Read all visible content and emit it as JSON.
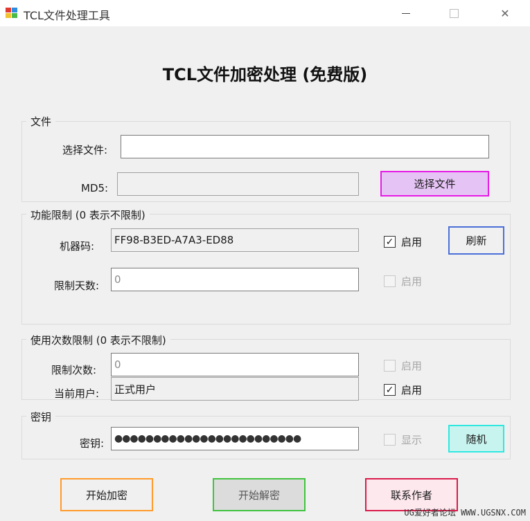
{
  "window": {
    "title": "TCL文件处理工具",
    "close_glyph": "✕"
  },
  "header": {
    "title": "TCL文件加密处理 (免费版)"
  },
  "file_group": {
    "legend": "文件",
    "select_label": "选择文件:",
    "select_value": "",
    "md5_label": "MD5:",
    "md5_value": "",
    "select_button": "选择文件"
  },
  "function_group": {
    "legend": "功能限制 (0 表示不限制)",
    "machine_label": "机器码:",
    "machine_value": "FF98-B3ED-A7A3-ED88",
    "machine_enable": {
      "label": "启用",
      "checked": true
    },
    "refresh_button": "刷新",
    "days_label": "限制天数:",
    "days_value": "0",
    "days_enable": {
      "label": "启用",
      "checked": false
    }
  },
  "usage_group": {
    "legend": "使用次数限制 (0 表示不限制)",
    "count_label": "限制次数:",
    "count_value": "0",
    "count_enable": {
      "label": "启用",
      "checked": false
    },
    "user_label": "当前用户:",
    "user_value": "正式用户",
    "user_enable": {
      "label": "启用",
      "checked": true
    }
  },
  "key_group": {
    "legend": "密钥",
    "key_label": "密钥:",
    "key_value": "●●●●●●●●●●●●●●●●●●●●●●●●",
    "show_toggle": {
      "label": "显示",
      "checked": false
    },
    "random_button": "随机"
  },
  "actions": {
    "encrypt": "开始加密",
    "decrypt": "开始解密",
    "contact": "联系作者"
  },
  "watermark": "UG爱好者论坛 WWW.UGSNX.COM",
  "colors": {
    "select_button_border": "#e619e6",
    "select_button_bg": "#e6c3f5",
    "refresh_border": "#4a6fd8",
    "random_border": "#2ee8e0",
    "random_bg": "#c8f4ef",
    "encrypt_border": "#ff9a2a",
    "decrypt_border": "#3fc43f",
    "contact_border": "#d81b4a",
    "contact_bg": "#fde8ee"
  }
}
